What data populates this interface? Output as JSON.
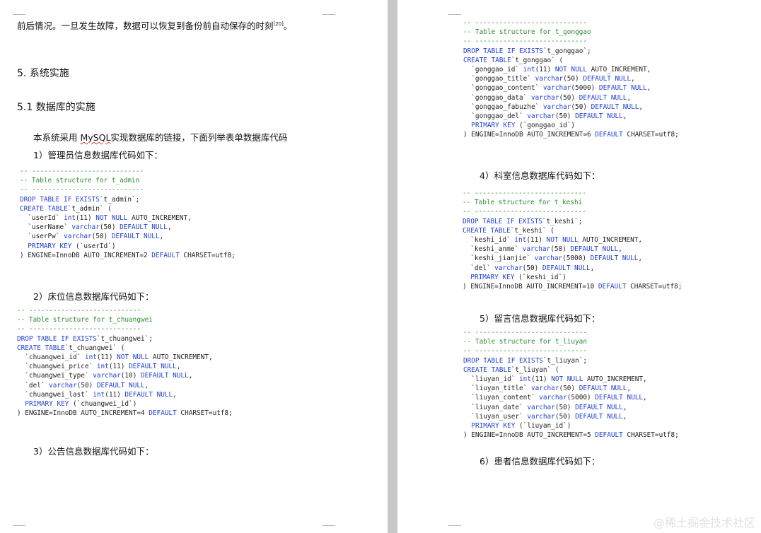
{
  "left": {
    "intro_line": "前后情况。一旦发生故障，数据可以恢复到备份前自动保存的时刻",
    "intro_ref": "[20]",
    "intro_end": "。",
    "section_title": "5. 系统实施",
    "subsection_title": "5.1 数据库的实施",
    "body_pre": "本系统采用 ",
    "body_mysql": "MySQL",
    "body_post": "实现数据库的链接，下面列举表单数据库代码",
    "item1": "1）管理员信息数据库代码如下：",
    "item2": "2）床位信息数据库代码如下：",
    "item3": "3）公告信息数据库代码如下："
  },
  "right": {
    "item4": "4）科室信息数据库代码如下：",
    "item5": "5）留言信息数据库代码如下：",
    "item6": "6）患者信息数据库代码如下："
  },
  "code_blocks": {
    "t_admin": [
      [
        [
          "c",
          "-- ----------------------------"
        ]
      ],
      [
        [
          "c",
          "-- Table structure for t_admin"
        ]
      ],
      [
        [
          "c",
          "-- ----------------------------"
        ]
      ],
      [
        [
          "k",
          "DROP TABLE IF EXISTS"
        ],
        [
          "",
          "`t_admin`;"
        ]
      ],
      [
        [
          "k",
          "CREATE TABLE"
        ],
        [
          "",
          "`t_admin` ("
        ]
      ],
      [
        [
          "",
          "  `userId` "
        ],
        [
          "k",
          "int"
        ],
        [
          "",
          "(11) "
        ],
        [
          "k",
          "NOT NULL"
        ],
        [
          "",
          " AUTO_INCREMENT,"
        ]
      ],
      [
        [
          "",
          "  `userName` "
        ],
        [
          "k",
          "varchar"
        ],
        [
          "",
          "(50) "
        ],
        [
          "k",
          "DEFAULT NULL"
        ],
        [
          "",
          ","
        ]
      ],
      [
        [
          "",
          "  `userPw` "
        ],
        [
          "k",
          "varchar"
        ],
        [
          "",
          "(50) "
        ],
        [
          "k",
          "DEFAULT NULL"
        ],
        [
          "",
          ","
        ]
      ],
      [
        [
          "",
          "  "
        ],
        [
          "k",
          "PRIMARY KEY"
        ],
        [
          "",
          " (`userId`)"
        ]
      ],
      [
        [
          "",
          ") ENGINE=InnoDB AUTO_INCREMENT=2 "
        ],
        [
          "k",
          "DEFAULT"
        ],
        [
          "",
          " CHARSET=utf8;"
        ]
      ]
    ],
    "t_chuangwei": [
      [
        [
          "c",
          "-- ----------------------------"
        ]
      ],
      [
        [
          "c",
          "-- Table structure for t_chuangwei"
        ]
      ],
      [
        [
          "c",
          "-- ----------------------------"
        ]
      ],
      [
        [
          "k",
          "DROP TABLE IF EXISTS"
        ],
        [
          "",
          "`t_chuangwei`;"
        ]
      ],
      [
        [
          "k",
          "CREATE TABLE"
        ],
        [
          "",
          "`t_chuangwei` ("
        ]
      ],
      [
        [
          "",
          "  `chuangwei_id` "
        ],
        [
          "k",
          "int"
        ],
        [
          "",
          "(11) "
        ],
        [
          "k",
          "NOT NULL"
        ],
        [
          "",
          " AUTO_INCREMENT,"
        ]
      ],
      [
        [
          "",
          "  `chuangwei_price` "
        ],
        [
          "k",
          "int"
        ],
        [
          "",
          "(11) "
        ],
        [
          "k",
          "DEFAULT NULL"
        ],
        [
          "",
          ","
        ]
      ],
      [
        [
          "",
          "  `chuangwei_type` "
        ],
        [
          "k",
          "varchar"
        ],
        [
          "",
          "(10) "
        ],
        [
          "k",
          "DEFAULT NULL"
        ],
        [
          "",
          ","
        ]
      ],
      [
        [
          "",
          "  `del` "
        ],
        [
          "k",
          "varchar"
        ],
        [
          "",
          "(50) "
        ],
        [
          "k",
          "DEFAULT NULL"
        ],
        [
          "",
          ","
        ]
      ],
      [
        [
          "",
          "  `chuangwei_last` "
        ],
        [
          "k",
          "int"
        ],
        [
          "",
          "(11) "
        ],
        [
          "k",
          "DEFAULT NULL"
        ],
        [
          "",
          ","
        ]
      ],
      [
        [
          "",
          "  "
        ],
        [
          "k",
          "PRIMARY KEY"
        ],
        [
          "",
          " (`chuangwei_id`)"
        ]
      ],
      [
        [
          "",
          ") ENGINE=InnoDB AUTO_INCREMENT=4 "
        ],
        [
          "k",
          "DEFAULT"
        ],
        [
          "",
          " CHARSET=utf8;"
        ]
      ]
    ],
    "t_gonggao": [
      [
        [
          "c",
          "-- ----------------------------"
        ]
      ],
      [
        [
          "c",
          "-- Table structure for t_gonggao"
        ]
      ],
      [
        [
          "c",
          "-- ----------------------------"
        ]
      ],
      [
        [
          "k",
          "DROP TABLE IF EXISTS"
        ],
        [
          "",
          "`t_gonggao`;"
        ]
      ],
      [
        [
          "k",
          "CREATE TABLE"
        ],
        [
          "",
          "`t_gonggao` ("
        ]
      ],
      [
        [
          "",
          "  `gonggao_id` "
        ],
        [
          "k",
          "int"
        ],
        [
          "",
          "(11) "
        ],
        [
          "k",
          "NOT NULL"
        ],
        [
          "",
          " AUTO_INCREMENT,"
        ]
      ],
      [
        [
          "",
          "  `gonggao_title` "
        ],
        [
          "k",
          "varchar"
        ],
        [
          "",
          "(50) "
        ],
        [
          "k",
          "DEFAULT NULL"
        ],
        [
          "",
          ","
        ]
      ],
      [
        [
          "",
          "  `gonggao_content` "
        ],
        [
          "k",
          "varchar"
        ],
        [
          "",
          "(5000) "
        ],
        [
          "k",
          "DEFAULT NULL"
        ],
        [
          "",
          ","
        ]
      ],
      [
        [
          "",
          "  `gonggao_data` "
        ],
        [
          "k",
          "varchar"
        ],
        [
          "",
          "(50) "
        ],
        [
          "k",
          "DEFAULT NULL"
        ],
        [
          "",
          ","
        ]
      ],
      [
        [
          "",
          "  `gonggao_fabuzhe` "
        ],
        [
          "k",
          "varchar"
        ],
        [
          "",
          "(50) "
        ],
        [
          "k",
          "DEFAULT NULL"
        ],
        [
          "",
          ","
        ]
      ],
      [
        [
          "",
          "  `gonggao_del` "
        ],
        [
          "k",
          "varchar"
        ],
        [
          "",
          "(50) "
        ],
        [
          "k",
          "DEFAULT NULL"
        ],
        [
          "",
          ","
        ]
      ],
      [
        [
          "",
          "  "
        ],
        [
          "k",
          "PRIMARY KEY"
        ],
        [
          "",
          " (`gonggao_id`)"
        ]
      ],
      [
        [
          "",
          ") ENGINE=InnoDB AUTO_INCREMENT=6 "
        ],
        [
          "k",
          "DEFAULT"
        ],
        [
          "",
          " CHARSET=utf8;"
        ]
      ]
    ],
    "t_keshi": [
      [
        [
          "c",
          "-- ----------------------------"
        ]
      ],
      [
        [
          "c",
          "-- Table structure for t_keshi"
        ]
      ],
      [
        [
          "c",
          "-- ----------------------------"
        ]
      ],
      [
        [
          "k",
          "DROP TABLE IF EXISTS"
        ],
        [
          "",
          "`t_keshi`;"
        ]
      ],
      [
        [
          "k",
          "CREATE TABLE"
        ],
        [
          "",
          "`t_keshi` ("
        ]
      ],
      [
        [
          "",
          "  `keshi_id` "
        ],
        [
          "k",
          "int"
        ],
        [
          "",
          "(11) "
        ],
        [
          "k",
          "NOT NULL"
        ],
        [
          "",
          " AUTO_INCREMENT,"
        ]
      ],
      [
        [
          "",
          "  `keshi_anme` "
        ],
        [
          "k",
          "varchar"
        ],
        [
          "",
          "(50) "
        ],
        [
          "k",
          "DEFAULT NULL"
        ],
        [
          "",
          ","
        ]
      ],
      [
        [
          "",
          "  `keshi_jianjie` "
        ],
        [
          "k",
          "varchar"
        ],
        [
          "",
          "(5000) "
        ],
        [
          "k",
          "DEFAULT NULL"
        ],
        [
          "",
          ","
        ]
      ],
      [
        [
          "",
          "  `del` "
        ],
        [
          "k",
          "varchar"
        ],
        [
          "",
          "(50) "
        ],
        [
          "k",
          "DEFAULT NULL"
        ],
        [
          "",
          ","
        ]
      ],
      [
        [
          "",
          "  "
        ],
        [
          "k",
          "PRIMARY KEY"
        ],
        [
          "",
          " (`keshi_id`)"
        ]
      ],
      [
        [
          "",
          ") ENGINE=InnoDB AUTO_INCREMENT=10 "
        ],
        [
          "k",
          "DEFAULT"
        ],
        [
          "",
          " CHARSET=utf8;"
        ]
      ]
    ],
    "t_liuyan": [
      [
        [
          "c",
          "-- ----------------------------"
        ]
      ],
      [
        [
          "c",
          "-- Table structure for t_liuyan"
        ]
      ],
      [
        [
          "c",
          "-- ----------------------------"
        ]
      ],
      [
        [
          "k",
          "DROP TABLE IF EXISTS"
        ],
        [
          "",
          "`t_liuyan`;"
        ]
      ],
      [
        [
          "k",
          "CREATE TABLE"
        ],
        [
          "",
          "`t_liuyan` ("
        ]
      ],
      [
        [
          "",
          "  `liuyan_id` "
        ],
        [
          "k",
          "int"
        ],
        [
          "",
          "(11) "
        ],
        [
          "k",
          "NOT NULL"
        ],
        [
          "",
          " AUTO_INCREMENT,"
        ]
      ],
      [
        [
          "",
          "  `liuyan_title` "
        ],
        [
          "k",
          "varchar"
        ],
        [
          "",
          "(50) "
        ],
        [
          "k",
          "DEFAULT NULL"
        ],
        [
          "",
          ","
        ]
      ],
      [
        [
          "",
          "  `liuyan_content` "
        ],
        [
          "k",
          "varchar"
        ],
        [
          "",
          "(5000) "
        ],
        [
          "k",
          "DEFAULT NULL"
        ],
        [
          "",
          ","
        ]
      ],
      [
        [
          "",
          "  `liuyan_date` "
        ],
        [
          "k",
          "varchar"
        ],
        [
          "",
          "(50) "
        ],
        [
          "k",
          "DEFAULT NULL"
        ],
        [
          "",
          ","
        ]
      ],
      [
        [
          "",
          "  `liuyan_user` "
        ],
        [
          "k",
          "varchar"
        ],
        [
          "",
          "(50) "
        ],
        [
          "k",
          "DEFAULT NULL"
        ],
        [
          "",
          ","
        ]
      ],
      [
        [
          "",
          "  "
        ],
        [
          "k",
          "PRIMARY KEY"
        ],
        [
          "",
          " (`liuyan_id`)"
        ]
      ],
      [
        [
          "",
          ") ENGINE=InnoDB AUTO_INCREMENT=5 "
        ],
        [
          "k",
          "DEFAULT"
        ],
        [
          "",
          " CHARSET=utf8;"
        ]
      ]
    ]
  },
  "watermark": "@稀土掘金技术社区"
}
